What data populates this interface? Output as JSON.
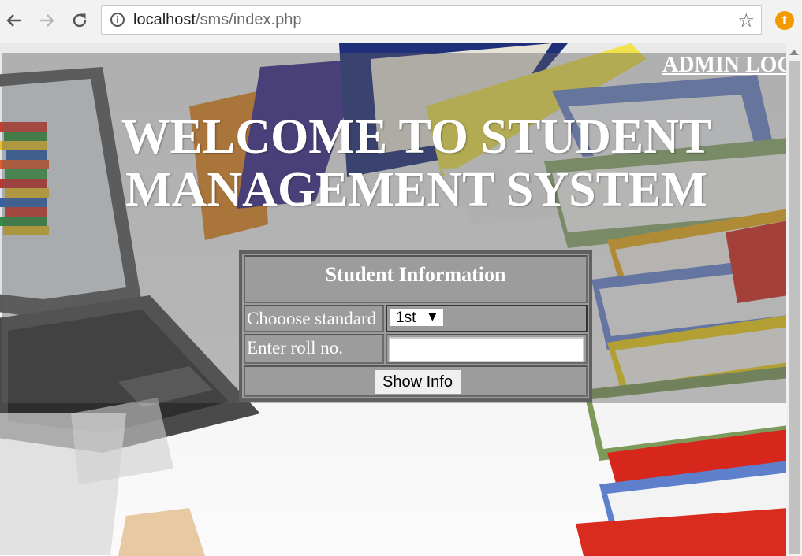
{
  "browser": {
    "url_host": "localhost",
    "url_path": "/sms/index.php",
    "icons": [
      "back-icon",
      "forward-icon",
      "reload-icon",
      "info-icon",
      "star-icon",
      "extension-icon"
    ]
  },
  "header": {
    "admin_link": "ADMIN LOGIN",
    "welcome_line1": "WELCOME TO STUDENT",
    "welcome_line2": "MANAGEMENT SYSTEM"
  },
  "form": {
    "caption": "Student Information",
    "standard_label": "Chooose standard",
    "standard_value": "1st",
    "roll_label": "Enter roll no.",
    "roll_value": "",
    "submit_label": "Show Info"
  },
  "colors": {
    "overlay": "#5f5f5f",
    "text": "#ffffff",
    "extension": "#f29900"
  }
}
